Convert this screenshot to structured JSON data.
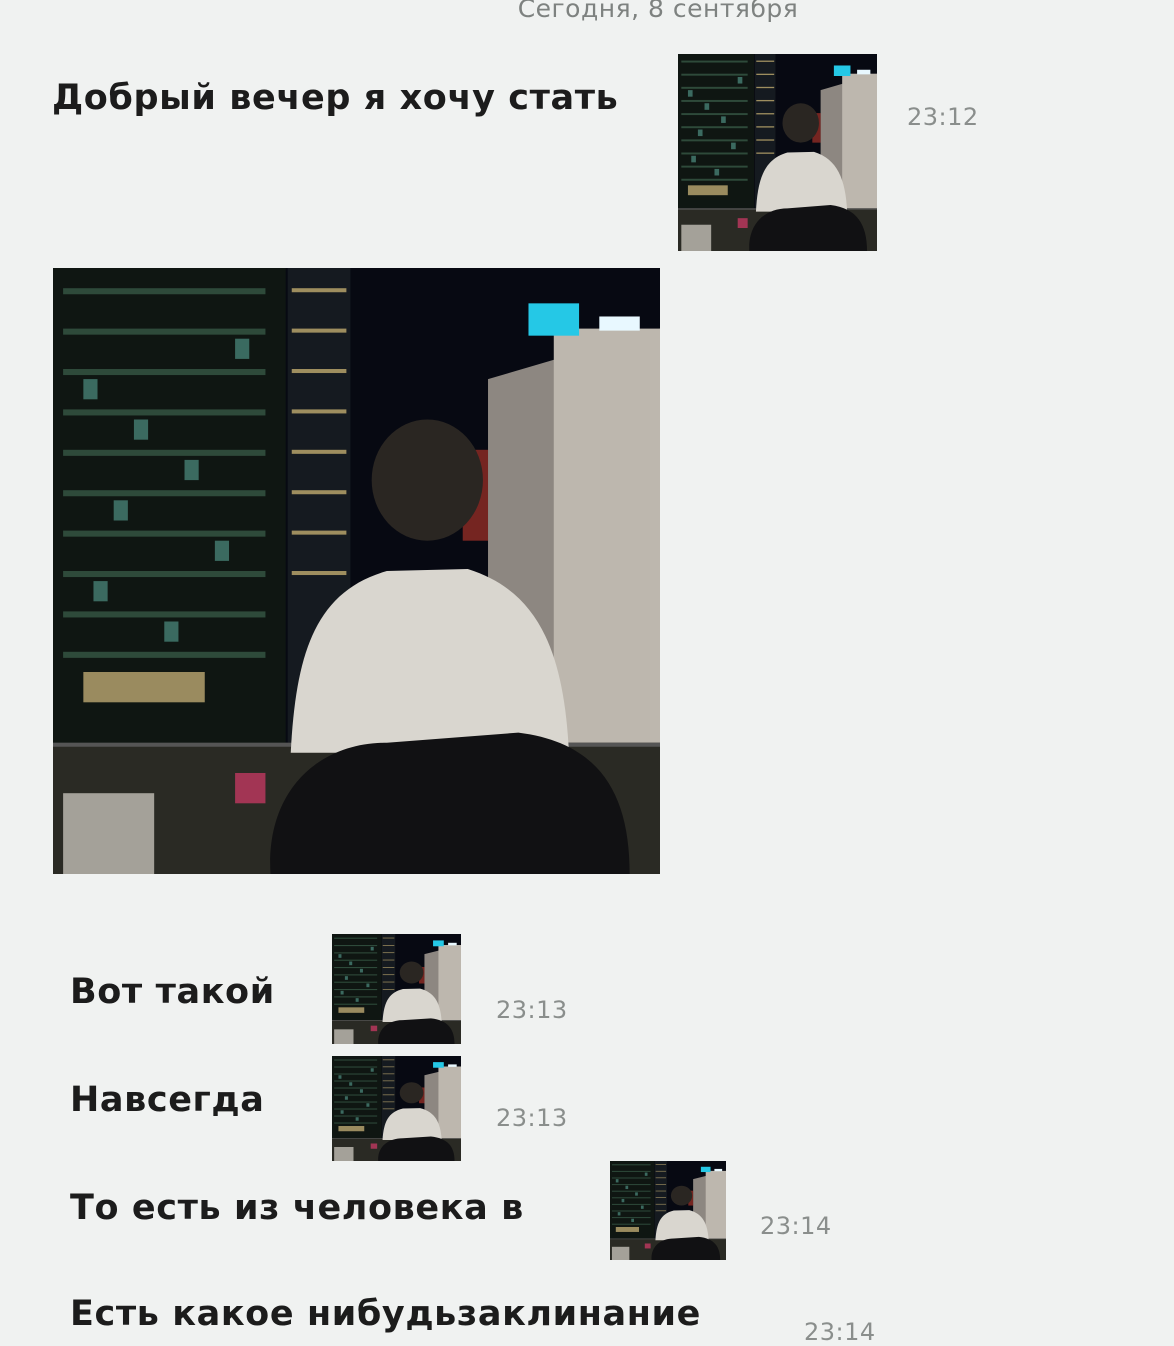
{
  "chat": {
    "date_separator": "Сегодня, 8 сентября",
    "messages": [
      {
        "text": "Добрый вечер я хочу стать",
        "time": "23:12",
        "image": "night-city-photo"
      },
      {
        "image": "night-city-photo-large"
      },
      {
        "text": "Вот такой",
        "time": "23:13",
        "image": "night-city-photo"
      },
      {
        "text": "Навсегда",
        "time": "23:13",
        "image": "night-city-photo"
      },
      {
        "text": "То есть из человека в",
        "time": "23:14",
        "image": "night-city-photo"
      },
      {
        "text": "Есть какое нибудьзаклинание",
        "time": "23:14"
      }
    ]
  },
  "colors": {
    "background": "#f0f2f1",
    "text": "#1c1c1c",
    "time": "#8a8e8c",
    "sign_cyan": "#25c8e6"
  }
}
